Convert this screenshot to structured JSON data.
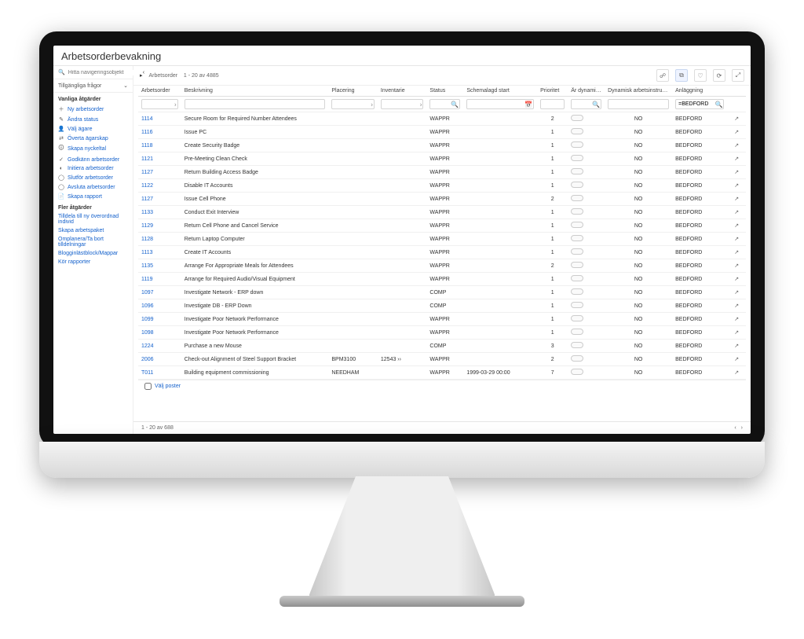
{
  "pageTitle": "Arbetsorderbevakning",
  "sidebar": {
    "searchPlaceholder": "Hitta navigeringsobjekt",
    "availableQueries": "Tillgängliga frågor",
    "groupCommon": "Vanliga åtgärder",
    "commonActions": [
      {
        "icon": "＋",
        "label": "Ny arbetsorder"
      },
      {
        "icon": "✎",
        "label": "Ändra status"
      },
      {
        "icon": "👤",
        "label": "Välj ägare"
      },
      {
        "icon": "⇄",
        "label": "Överta ägarskap"
      },
      {
        "icon": "🛈",
        "label": "Skapa nyckeltal"
      },
      {
        "icon": "✓",
        "label": "Godkänn arbetsorder"
      },
      {
        "icon": "◐",
        "label": "Initiera arbetsorder"
      },
      {
        "icon": "◯",
        "label": "Slutför arbetsorder"
      },
      {
        "icon": "◯",
        "label": "Avsluta arbetsorder"
      },
      {
        "icon": "📄",
        "label": "Skapa rapport"
      }
    ],
    "groupMore": "Fler åtgärder",
    "moreActions": [
      "Tilldela till ny överordnad individ",
      "Skapa arbetspaket",
      "Omplanera/Ta bort tilldelningar",
      "Blogginlästblock/Mappar",
      "Kör rapporter"
    ]
  },
  "toolbar": {
    "crumbLabel": "Arbetsorder",
    "crumbRange": "1 - 20 av 4885",
    "icons": [
      "☍",
      "⧉",
      "♡",
      "⟳",
      "⤢"
    ]
  },
  "columns": {
    "workorder": "Arbetsorder",
    "description": "Beskrivning",
    "location": "Placering",
    "inventory": "Inventarie",
    "status": "Status",
    "schedStart": "Schemalagd start",
    "priority": "Prioritet",
    "dynamic": "Är dynamisk?",
    "dynamicInstr": "Dynamisk arbetsinstruktion tillämpad",
    "site": "Anläggning"
  },
  "filters": {
    "siteDefault": "=BEDFORD"
  },
  "rows": [
    {
      "wo": "1114",
      "desc": "Secure Room for Required Number Attendees",
      "loc": "",
      "inv": "",
      "status": "WAPPR",
      "start": "",
      "prio": "2",
      "dyn": "NO",
      "site": "BEDFORD"
    },
    {
      "wo": "1116",
      "desc": "Issue PC",
      "loc": "",
      "inv": "",
      "status": "WAPPR",
      "start": "",
      "prio": "1",
      "dyn": "NO",
      "site": "BEDFORD"
    },
    {
      "wo": "1118",
      "desc": "Create Security Badge",
      "loc": "",
      "inv": "",
      "status": "WAPPR",
      "start": "",
      "prio": "1",
      "dyn": "NO",
      "site": "BEDFORD"
    },
    {
      "wo": "1121",
      "desc": "Pre-Meeting Clean Check",
      "loc": "",
      "inv": "",
      "status": "WAPPR",
      "start": "",
      "prio": "1",
      "dyn": "NO",
      "site": "BEDFORD"
    },
    {
      "wo": "1127",
      "desc": "Return Building Access Badge",
      "loc": "",
      "inv": "",
      "status": "WAPPR",
      "start": "",
      "prio": "1",
      "dyn": "NO",
      "site": "BEDFORD"
    },
    {
      "wo": "1122",
      "desc": "Disable IT Accounts",
      "loc": "",
      "inv": "",
      "status": "WAPPR",
      "start": "",
      "prio": "1",
      "dyn": "NO",
      "site": "BEDFORD"
    },
    {
      "wo": "1127",
      "desc": "Issue Cell Phone",
      "loc": "",
      "inv": "",
      "status": "WAPPR",
      "start": "",
      "prio": "2",
      "dyn": "NO",
      "site": "BEDFORD"
    },
    {
      "wo": "1133",
      "desc": "Conduct Exit Interview",
      "loc": "",
      "inv": "",
      "status": "WAPPR",
      "start": "",
      "prio": "1",
      "dyn": "NO",
      "site": "BEDFORD"
    },
    {
      "wo": "1129",
      "desc": "Return Cell Phone and Cancel Service",
      "loc": "",
      "inv": "",
      "status": "WAPPR",
      "start": "",
      "prio": "1",
      "dyn": "NO",
      "site": "BEDFORD"
    },
    {
      "wo": "1128",
      "desc": "Return Laptop Computer",
      "loc": "",
      "inv": "",
      "status": "WAPPR",
      "start": "",
      "prio": "1",
      "dyn": "NO",
      "site": "BEDFORD"
    },
    {
      "wo": "1113",
      "desc": "Create IT Accounts",
      "loc": "",
      "inv": "",
      "status": "WAPPR",
      "start": "",
      "prio": "1",
      "dyn": "NO",
      "site": "BEDFORD"
    },
    {
      "wo": "1135",
      "desc": "Arrange For Appropriate Meals for Attendees",
      "loc": "",
      "inv": "",
      "status": "WAPPR",
      "start": "",
      "prio": "2",
      "dyn": "NO",
      "site": "BEDFORD"
    },
    {
      "wo": "1119",
      "desc": "Arrange for Required Audio/Visual Equipment",
      "loc": "",
      "inv": "",
      "status": "WAPPR",
      "start": "",
      "prio": "1",
      "dyn": "NO",
      "site": "BEDFORD"
    },
    {
      "wo": "1097",
      "desc": "Investigate Network - ERP down",
      "loc": "",
      "inv": "",
      "status": "COMP",
      "start": "",
      "prio": "1",
      "dyn": "NO",
      "site": "BEDFORD"
    },
    {
      "wo": "1096",
      "desc": "Investigate DB - ERP Down",
      "loc": "",
      "inv": "",
      "status": "COMP",
      "start": "",
      "prio": "1",
      "dyn": "NO",
      "site": "BEDFORD"
    },
    {
      "wo": "1099",
      "desc": "Investigate Poor Network Performance",
      "loc": "",
      "inv": "",
      "status": "WAPPR",
      "start": "",
      "prio": "1",
      "dyn": "NO",
      "site": "BEDFORD"
    },
    {
      "wo": "1098",
      "desc": "Investigate Poor Network Performance",
      "loc": "",
      "inv": "",
      "status": "WAPPR",
      "start": "",
      "prio": "1",
      "dyn": "NO",
      "site": "BEDFORD"
    },
    {
      "wo": "1224",
      "desc": "Purchase a new Mouse",
      "loc": "",
      "inv": "",
      "status": "COMP",
      "start": "",
      "prio": "3",
      "dyn": "NO",
      "site": "BEDFORD"
    },
    {
      "wo": "2006",
      "desc": "Check-out Alignment of Steel Support Bracket",
      "loc": "BPM3100",
      "inv": "12543 ››",
      "status": "WAPPR",
      "start": "",
      "prio": "2",
      "dyn": "NO",
      "site": "BEDFORD"
    },
    {
      "wo": "T011",
      "desc": "Building equipment commissioning",
      "loc": "NEEDHAM",
      "inv": "",
      "status": "WAPPR",
      "start": "1999-03-29 00:00",
      "prio": "7",
      "dyn": "NO",
      "site": "BEDFORD"
    }
  ],
  "selectAll": "Välj poster",
  "footer": {
    "range": "1 - 20 av 688",
    "prev": "‹",
    "next": "›"
  }
}
